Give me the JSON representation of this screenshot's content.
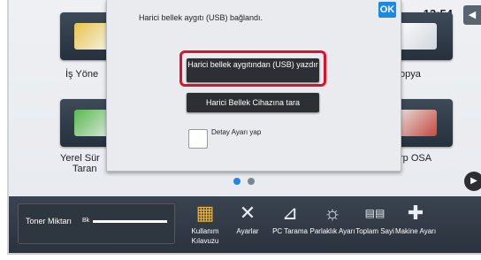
{
  "clock": "13:54",
  "apps": [
    {
      "label_visible": "İş Yöne",
      "icon": "job-status-icon"
    },
    {
      "label_visible": "opya",
      "icon": "copy-icon"
    },
    {
      "label_visible": "Yerel Sür",
      "label2": "Taran",
      "icon": "local-drive-scan-icon"
    },
    {
      "label_visible": "rp OSA",
      "icon": "sharp-osa-icon"
    }
  ],
  "toner": {
    "label": "Toner Miktarı",
    "color_code": "Bk",
    "level": 1.0
  },
  "bottom_items": [
    {
      "label": "Kullanım Kılavuzu",
      "icon": "manual-icon"
    },
    {
      "label": "Ayarlar",
      "icon": "settings-tools-icon"
    },
    {
      "label": "PC Tarama",
      "icon": "pc-scan-icon"
    },
    {
      "label": "Parlaklık Ayarı",
      "icon": "brightness-icon"
    },
    {
      "label": "Toplam Sayi",
      "icon": "total-count-icon"
    },
    {
      "label": "Makine Ayarı",
      "icon": "machine-settings-icon"
    }
  ],
  "dialog": {
    "message": "Harici bellek aygıtı (USB) bağlandı.",
    "ok_label": "OK",
    "buttons": [
      "Harici bellek aygıtından (USB) yazdır",
      "Harici Bellek Cihazına tara"
    ],
    "checkbox_label": "Detay Ayarı yap"
  },
  "colors": {
    "accent_ok": "#1e88e5",
    "highlight": "#e0102a",
    "dot_active": "#1e88e5",
    "dot_inactive": "#7b8591"
  }
}
